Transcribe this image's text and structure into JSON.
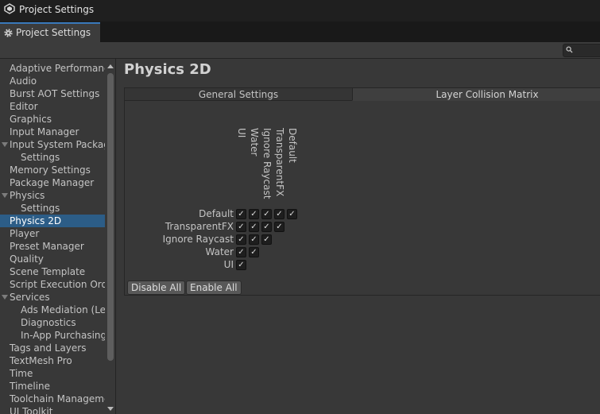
{
  "window": {
    "title": "Project Settings"
  },
  "tab": {
    "label": "Project Settings"
  },
  "search": {
    "placeholder": ""
  },
  "sidebar": {
    "items": [
      {
        "label": "Adaptive Performance",
        "indent": 0,
        "expandable": false
      },
      {
        "label": "Audio",
        "indent": 0,
        "expandable": false
      },
      {
        "label": "Burst AOT Settings",
        "indent": 0,
        "expandable": false
      },
      {
        "label": "Editor",
        "indent": 0,
        "expandable": false
      },
      {
        "label": "Graphics",
        "indent": 0,
        "expandable": false
      },
      {
        "label": "Input Manager",
        "indent": 0,
        "expandable": false
      },
      {
        "label": "Input System Package",
        "indent": 0,
        "expandable": true
      },
      {
        "label": "Settings",
        "indent": 1,
        "expandable": false
      },
      {
        "label": "Memory Settings",
        "indent": 0,
        "expandable": false
      },
      {
        "label": "Package Manager",
        "indent": 0,
        "expandable": false
      },
      {
        "label": "Physics",
        "indent": 0,
        "expandable": true
      },
      {
        "label": "Settings",
        "indent": 1,
        "expandable": false
      },
      {
        "label": "Physics 2D",
        "indent": 0,
        "expandable": false,
        "selected": true
      },
      {
        "label": "Player",
        "indent": 0,
        "expandable": false
      },
      {
        "label": "Preset Manager",
        "indent": 0,
        "expandable": false
      },
      {
        "label": "Quality",
        "indent": 0,
        "expandable": false
      },
      {
        "label": "Scene Template",
        "indent": 0,
        "expandable": false
      },
      {
        "label": "Script Execution Order",
        "indent": 0,
        "expandable": false
      },
      {
        "label": "Services",
        "indent": 0,
        "expandable": true
      },
      {
        "label": "Ads Mediation (Levelplay)",
        "indent": 1,
        "expandable": false
      },
      {
        "label": "Diagnostics",
        "indent": 1,
        "expandable": false
      },
      {
        "label": "In-App Purchasing",
        "indent": 1,
        "expandable": false
      },
      {
        "label": "Tags and Layers",
        "indent": 0,
        "expandable": false
      },
      {
        "label": "TextMesh Pro",
        "indent": 0,
        "expandable": false
      },
      {
        "label": "Time",
        "indent": 0,
        "expandable": false
      },
      {
        "label": "Timeline",
        "indent": 0,
        "expandable": false
      },
      {
        "label": "Toolchain Management",
        "indent": 0,
        "expandable": false
      },
      {
        "label": "UI Toolkit",
        "indent": 0,
        "expandable": false
      }
    ]
  },
  "main": {
    "title": "Physics 2D",
    "tabs": [
      {
        "label": "General Settings",
        "active": false
      },
      {
        "label": "Layer Collision Matrix",
        "active": true
      }
    ],
    "matrix": {
      "columns": [
        "UI",
        "Water",
        "Ignore Raycast",
        "TransparentFX",
        "Default"
      ],
      "rows": [
        {
          "label": "Default",
          "checks": [
            true,
            true,
            true,
            true,
            true
          ]
        },
        {
          "label": "TransparentFX",
          "checks": [
            true,
            true,
            true,
            true
          ]
        },
        {
          "label": "Ignore Raycast",
          "checks": [
            true,
            true,
            true
          ]
        },
        {
          "label": "Water",
          "checks": [
            true,
            true
          ]
        },
        {
          "label": "UI",
          "checks": [
            true
          ]
        }
      ],
      "check_glyph": "✓"
    },
    "buttons": {
      "disable_all": "Disable All",
      "enable_all": "Enable All"
    }
  },
  "colors": {
    "selection": "#2c5d87",
    "tab_accent": "#3a79bb"
  }
}
